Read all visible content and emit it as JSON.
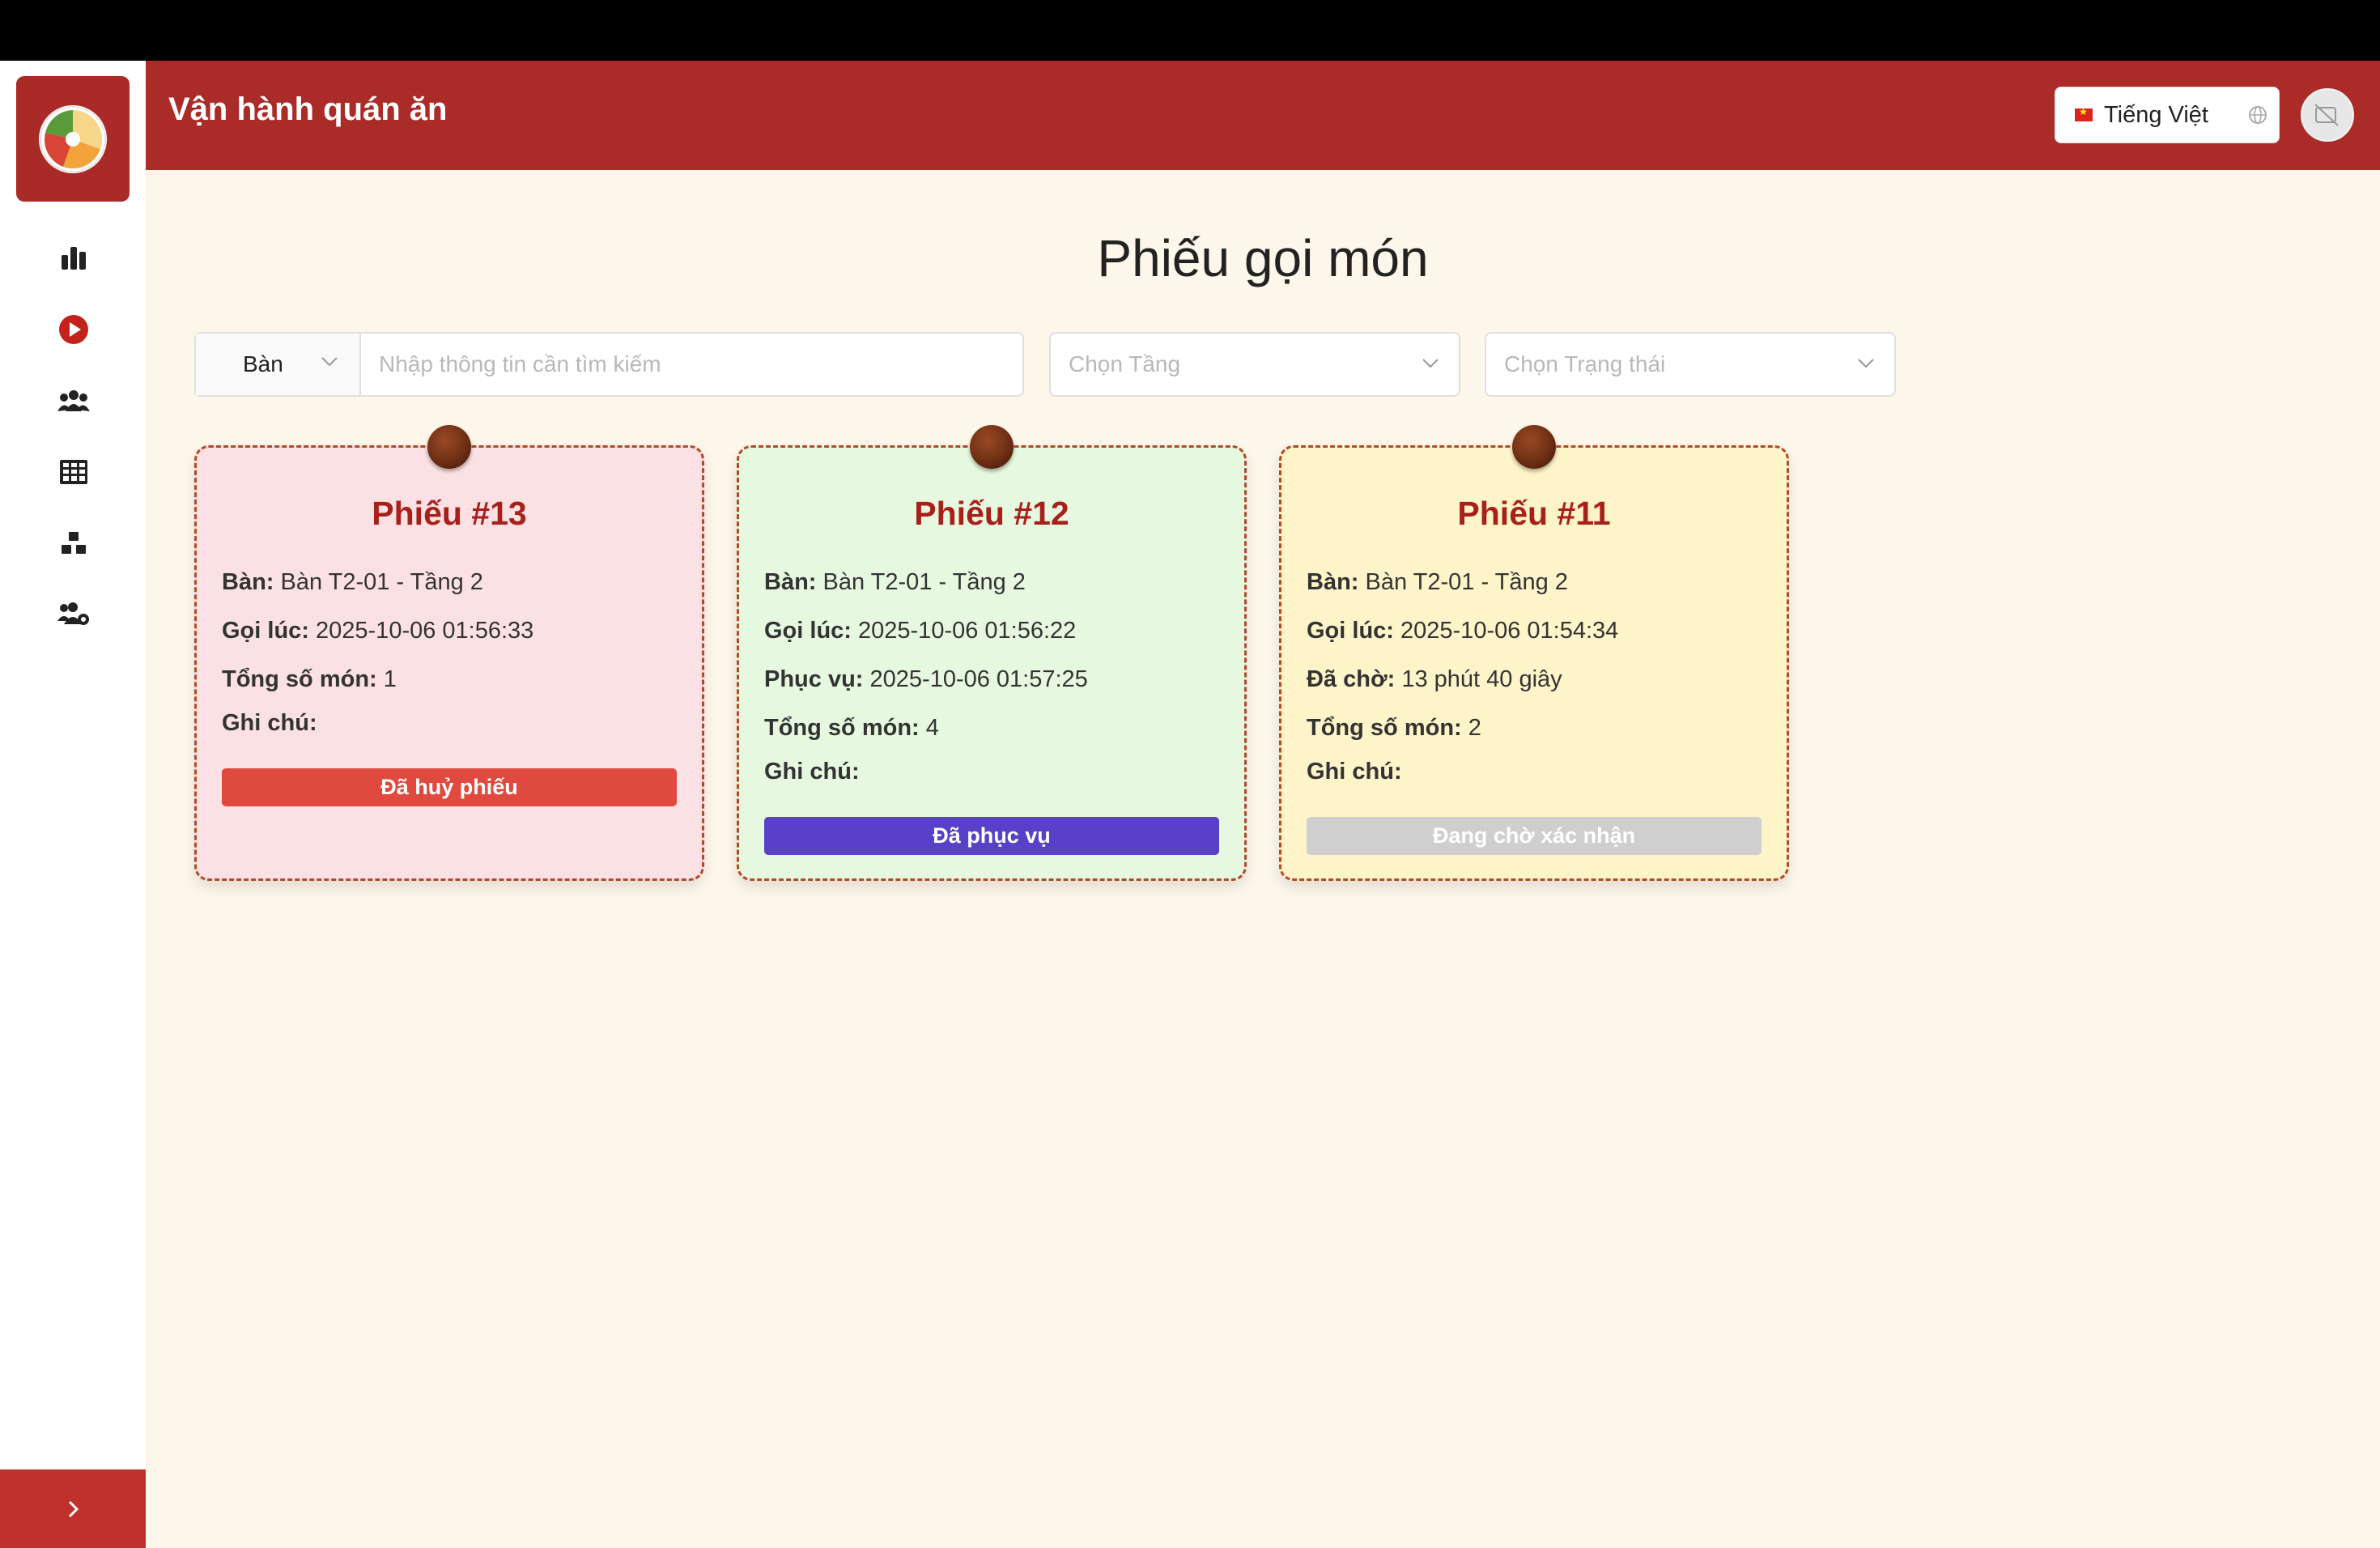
{
  "header": {
    "title": "Vận hành quán ăn",
    "language": "Tiếng Việt"
  },
  "sidebar": {
    "items": [
      {
        "icon": "bar-chart-icon"
      },
      {
        "icon": "play-circle-icon"
      },
      {
        "icon": "group-icon"
      },
      {
        "icon": "table-grid-icon"
      },
      {
        "icon": "boxes-icon"
      },
      {
        "icon": "users-cog-icon"
      }
    ],
    "collapse_icon": "chevron-right-icon"
  },
  "page": {
    "title": "Phiếu gọi món"
  },
  "filters": {
    "search_type": "Bàn",
    "search_placeholder": "Nhập thông tin cần tìm kiếm",
    "floor_placeholder": "Chọn Tầng",
    "status_placeholder": "Chọn Trạng thái"
  },
  "tickets": [
    {
      "title": "Phiếu #13",
      "table_label": "Bàn:",
      "table_value": "Bàn T2-01 - Tầng 2",
      "order_label": "Gọi lúc:",
      "order_value": "2025-10-06 01:56:33",
      "count_label": "Tổng số món:",
      "count_value": "1",
      "note_label": "Ghi chú:",
      "status": "Đã huỷ phiếu",
      "bg_color": "#fbe1e3",
      "status_color": "#e0493e"
    },
    {
      "title": "Phiếu #12",
      "table_label": "Bàn:",
      "table_value": "Bàn T2-01 - Tầng 2",
      "order_label": "Gọi lúc:",
      "order_value": "2025-10-06 01:56:22",
      "served_label": "Phục vụ:",
      "served_value": "2025-10-06 01:57:25",
      "count_label": "Tổng số món:",
      "count_value": "4",
      "note_label": "Ghi chú:",
      "status": "Đã phục vụ",
      "bg_color": "#e6f8e0",
      "status_color": "#5840c8"
    },
    {
      "title": "Phiếu #11",
      "table_label": "Bàn:",
      "table_value": "Bàn T2-01 - Tầng 2",
      "order_label": "Gọi lúc:",
      "order_value": "2025-10-06 01:54:34",
      "waited_label": "Đã chờ:",
      "waited_value": "13 phút 40 giây",
      "count_label": "Tổng số món:",
      "count_value": "2",
      "note_label": "Ghi chú:",
      "status": "Đang chờ xác nhận",
      "bg_color": "#fdf4c9",
      "status_color": "#cfcfcf"
    }
  ]
}
